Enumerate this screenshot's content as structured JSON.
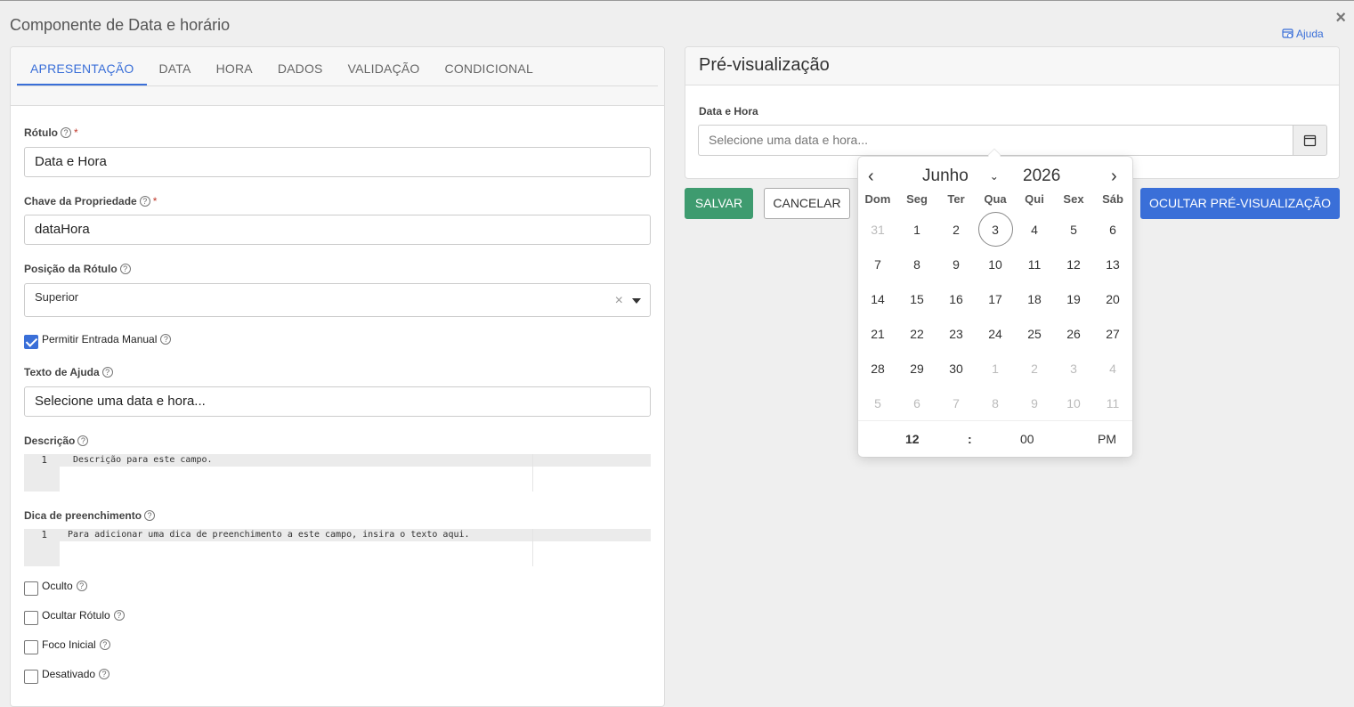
{
  "dialog": {
    "title": "Componente de Data e horário",
    "help_label": "Ajuda",
    "close_glyph": "×"
  },
  "tabs": [
    {
      "label": "APRESENTAÇÃO",
      "active": true
    },
    {
      "label": "DATA"
    },
    {
      "label": "HORA"
    },
    {
      "label": "DADOS"
    },
    {
      "label": "VALIDAÇÃO"
    },
    {
      "label": "CONDICIONAL"
    }
  ],
  "form": {
    "label_field": {
      "label": "Rótulo",
      "required": "*",
      "value": "Data e Hora"
    },
    "key_field": {
      "label": "Chave da Propriedade",
      "required": "*",
      "value": "dataHora"
    },
    "label_position": {
      "label": "Posição da Rótulo",
      "value": "Superior",
      "clear": "×"
    },
    "manual_entry": {
      "label": "Permitir Entrada Manual",
      "checked": true
    },
    "help_text": {
      "label": "Texto de Ajuda",
      "value": "Selecione uma data e hora..."
    },
    "description": {
      "label": "Descrição",
      "line_no": "1",
      "code": "Descrição para este campo."
    },
    "tooltip": {
      "label": "Dica de preenchimento",
      "line_no": "1",
      "code": "Para adicionar uma dica de preenchimento a este campo, insira o texto aqui."
    },
    "hidden": {
      "label": "Oculto",
      "checked": false
    },
    "hide_label": {
      "label": "Ocultar Rótulo",
      "checked": false
    },
    "autofocus": {
      "label": "Foco Inicial",
      "checked": false
    },
    "disabled": {
      "label": "Desativado",
      "checked": false
    }
  },
  "preview": {
    "title": "Pré-visualização",
    "field_label": "Data e Hora",
    "placeholder": "Selecione uma data e hora..."
  },
  "buttons": {
    "save": "SALVAR",
    "cancel": "CANCELAR",
    "hide_preview": "OCULTAR PRÉ-VISUALIZAÇÃO"
  },
  "calendar": {
    "month": "Junho",
    "year": "2026",
    "weekdays": [
      "Dom",
      "Seg",
      "Ter",
      "Qua",
      "Qui",
      "Sex",
      "Sáb"
    ],
    "days": [
      {
        "d": "31",
        "other": true
      },
      {
        "d": "1"
      },
      {
        "d": "2"
      },
      {
        "d": "3",
        "today": true
      },
      {
        "d": "4"
      },
      {
        "d": "5"
      },
      {
        "d": "6"
      },
      {
        "d": "7"
      },
      {
        "d": "8"
      },
      {
        "d": "9"
      },
      {
        "d": "10"
      },
      {
        "d": "11"
      },
      {
        "d": "12"
      },
      {
        "d": "13"
      },
      {
        "d": "14"
      },
      {
        "d": "15"
      },
      {
        "d": "16"
      },
      {
        "d": "17"
      },
      {
        "d": "18"
      },
      {
        "d": "19"
      },
      {
        "d": "20"
      },
      {
        "d": "21"
      },
      {
        "d": "22"
      },
      {
        "d": "23"
      },
      {
        "d": "24"
      },
      {
        "d": "25"
      },
      {
        "d": "26"
      },
      {
        "d": "27"
      },
      {
        "d": "28"
      },
      {
        "d": "29"
      },
      {
        "d": "30"
      },
      {
        "d": "1",
        "other": true
      },
      {
        "d": "2",
        "other": true
      },
      {
        "d": "3",
        "other": true
      },
      {
        "d": "4",
        "other": true
      },
      {
        "d": "5",
        "other": true
      },
      {
        "d": "6",
        "other": true
      },
      {
        "d": "7",
        "other": true
      },
      {
        "d": "8",
        "other": true
      },
      {
        "d": "9",
        "other": true
      },
      {
        "d": "10",
        "other": true
      },
      {
        "d": "11",
        "other": true
      }
    ],
    "time": {
      "hour": "12",
      "separator": ":",
      "minute": "00",
      "ampm": "PM"
    }
  },
  "colors": {
    "accent": "#3a6fd8",
    "save": "#3e9b6f"
  },
  "icons": {
    "help": "help-icon",
    "calendar": "calendar-icon",
    "close": "close-icon",
    "question": "question-circle-icon"
  }
}
